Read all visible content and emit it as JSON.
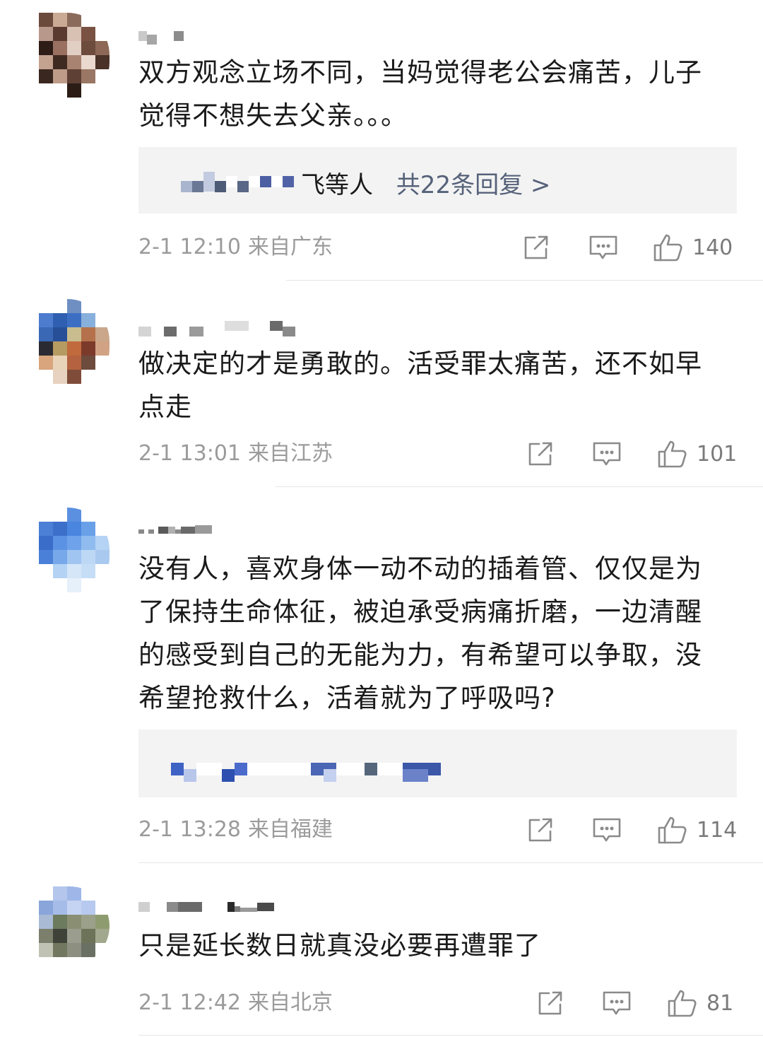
{
  "comments": [
    {
      "text": "双方观念立场不同，当妈觉得老公会痛苦，儿子觉得不想失去父亲。。。",
      "reply_names_suffix": "飞等人",
      "reply_summary": "共22条回复 >",
      "date": "2-1 12:10",
      "location": "来自广东",
      "likes": "140"
    },
    {
      "text": "做决定的才是勇敢的。活受罪太痛苦，还不如早点走",
      "date": "2-1 13:01",
      "location": "来自江苏",
      "likes": "101"
    },
    {
      "text": "没有人，喜欢身体一动不动的插着管、仅仅是为了保持生命体征，被迫承受病痛折磨，一边清醒的感受到自己的无能为力，有希望可以争取，没希望抢救什么，活着就为了呼吸吗?",
      "date": "2-1 13:28",
      "location": "来自福建",
      "likes": "114"
    },
    {
      "text": "只是延长数日就真没必要再遭罪了",
      "date": "2-1 12:42",
      "location": "来自北京",
      "likes": "81"
    }
  ],
  "icons": {
    "share": "share-icon",
    "comment": "comment-icon",
    "like": "thumbs-up-icon"
  },
  "colors": {
    "reply_link": "#56627a",
    "meta_text": "#9b9b9b",
    "reply_bg": "#f3f3f3"
  }
}
